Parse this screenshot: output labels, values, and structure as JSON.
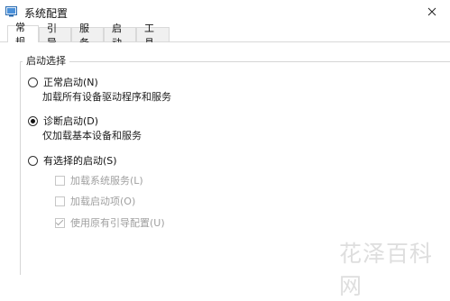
{
  "window": {
    "title": "系统配置"
  },
  "tabs": [
    {
      "label": "常规"
    },
    {
      "label": "引导"
    },
    {
      "label": "服务"
    },
    {
      "label": "启动"
    },
    {
      "label": "工具"
    }
  ],
  "startup_selection": {
    "group_label": "启动选择",
    "options": [
      {
        "label": "正常启动(N)",
        "description": "加载所有设备驱动程序和服务",
        "selected": false
      },
      {
        "label": "诊断启动(D)",
        "description": "仅加载基本设备和服务",
        "selected": true
      },
      {
        "label": "有选择的启动(S)",
        "selected": false
      }
    ],
    "checkboxes": [
      {
        "label": "加载系统服务(L)",
        "checked": false
      },
      {
        "label": "加载启动项(O)",
        "checked": false
      },
      {
        "label": "使用原有引导配置(U)",
        "checked": true
      }
    ]
  },
  "watermark": "花泽百科网",
  "colors": {
    "tab_border": "#d9d9d9",
    "disabled_text": "#a0a0a0"
  }
}
